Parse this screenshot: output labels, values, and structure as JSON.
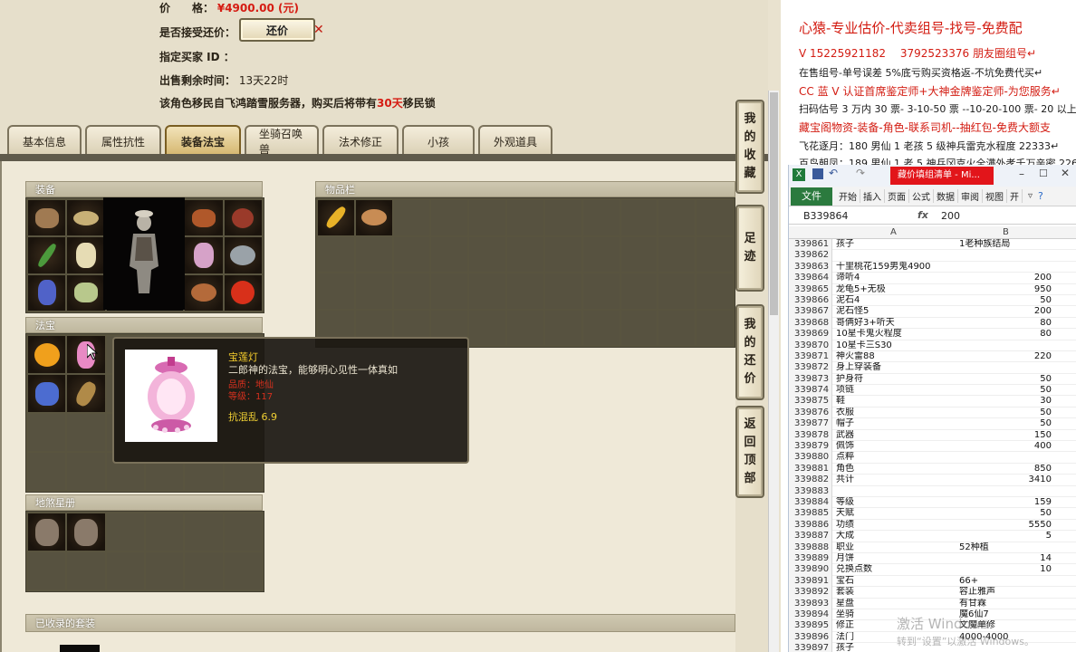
{
  "game": {
    "price_label": "价　　格：",
    "price_value": "¥4900.00 (元)",
    "accept_bargain_label": "是否接受还价：",
    "bargain_button": "还价",
    "designated_buyer_label": "指定买家 ID ：",
    "time_left_label": "出售剩余时间：",
    "time_left_value": "13天22时",
    "migration_note_pre": "该角色移民自飞鸿踏雪服务器，购买后将带有",
    "migration_days": "30天",
    "migration_note_post": "移民锁",
    "tabs": [
      "基本信息",
      "属性抗性",
      "装备法宝",
      "坐骑召唤兽",
      "法术修正",
      "小孩",
      "外观道具"
    ],
    "active_tab": "装备法宝",
    "panels": {
      "equipment": "装备",
      "items": "物品栏",
      "treasure": "法宝",
      "earth_book": "地煞星册",
      "collected_sets": "已收录的套装"
    },
    "tooltip": {
      "name": "宝莲灯",
      "desc": "二郎神的法宝，能够明心见性一体真如",
      "line1": "品质：地仙",
      "line2": "等级：117",
      "stat": "抗混乱 6.9"
    },
    "side_buttons": [
      [
        "我",
        "的",
        "收",
        "藏"
      ],
      [
        "足",
        "迹"
      ],
      [
        "我",
        "的",
        "还",
        "价"
      ],
      [
        "返",
        "回",
        "顶",
        "部"
      ]
    ]
  },
  "ad": {
    "line1": "心猿-专业估价-代卖组号-找号-免费配",
    "line2": "V 15225921182　 3792523376 朋友圈组号↵",
    "line3": "在售组号-单号误差 5%底亏购买资格返-不坑免费代买↵",
    "line4": "CC 蓝 V 认证首席鉴定师+大神金牌鉴定师-为您服务↵",
    "line5": "扫码估号 3 万内 30 票- 3-10-50 票 --10-20-100 票- 20 以上 150",
    "line6": "藏宝阁物资-装备-角色-联系司机--抽红包-免费大额支",
    "line7": "飞花逐月：180 男仙 1 老孩 5 级神兵雷克水程度 22333↵",
    "line8": "百鸟朝凤：189 男仙 1 老 5 神兵冈克火全满外孝千万亲密 226"
  },
  "excel": {
    "window_title": "藏价填组清单 - Mi...",
    "file_tab": "文件",
    "ribbon_tabs": [
      "开始",
      "插入",
      "页面",
      "公式",
      "数据",
      "审阅",
      "视图",
      "开"
    ],
    "name_box": "B339864",
    "fx": "fx",
    "formula_value": "200",
    "col_a": "A",
    "col_b": "B",
    "rows": [
      {
        "n": "339861",
        "a": "孩子",
        "b": "1老种族结局",
        "bn": false
      },
      {
        "n": "339862",
        "a": "",
        "b": "",
        "bn": false
      },
      {
        "n": "339863",
        "a": "十里桃花159男鬼4900",
        "b": "",
        "bn": false
      },
      {
        "n": "339864",
        "a": "谛听4",
        "b": "200",
        "bn": true
      },
      {
        "n": "339865",
        "a": "龙龟5+无极",
        "b": "950",
        "bn": true
      },
      {
        "n": "339866",
        "a": "泥石4",
        "b": "50",
        "bn": true
      },
      {
        "n": "339867",
        "a": "泥石怪5",
        "b": "200",
        "bn": true
      },
      {
        "n": "339868",
        "a": "哥俩好3+听天",
        "b": "80",
        "bn": true
      },
      {
        "n": "339869",
        "a": "10星卡鬼火程度",
        "b": "80",
        "bn": true
      },
      {
        "n": "339870",
        "a": "10星卡三S30",
        "b": "",
        "bn": false
      },
      {
        "n": "339871",
        "a": "神火雷88",
        "b": "220",
        "bn": true
      },
      {
        "n": "339872",
        "a": "身上穿装备",
        "b": "",
        "bn": false
      },
      {
        "n": "339873",
        "a": "护身符",
        "b": "50",
        "bn": true
      },
      {
        "n": "339874",
        "a": "项链",
        "b": "50",
        "bn": true
      },
      {
        "n": "339875",
        "a": "鞋",
        "b": "30",
        "bn": true
      },
      {
        "n": "339876",
        "a": "衣服",
        "b": "50",
        "bn": true
      },
      {
        "n": "339877",
        "a": "帽子",
        "b": "50",
        "bn": true
      },
      {
        "n": "339878",
        "a": "武器",
        "b": "150",
        "bn": true
      },
      {
        "n": "339879",
        "a": "佩饰",
        "b": "400",
        "bn": true
      },
      {
        "n": "339880",
        "a": "点粹",
        "b": "",
        "bn": false
      },
      {
        "n": "339881",
        "a": "角色",
        "b": "850",
        "bn": true
      },
      {
        "n": "339882",
        "a": "共计",
        "b": "3410",
        "bn": true
      },
      {
        "n": "339883",
        "a": "",
        "b": "",
        "bn": false
      },
      {
        "n": "339884",
        "a": "等级",
        "b": "159",
        "bn": true
      },
      {
        "n": "339885",
        "a": "天赋",
        "b": "50",
        "bn": true
      },
      {
        "n": "339886",
        "a": "功绩",
        "b": "5550",
        "bn": true
      },
      {
        "n": "339887",
        "a": "大成",
        "b": "5",
        "bn": true
      },
      {
        "n": "339888",
        "a": "职业",
        "b": "52种植",
        "bn": false
      },
      {
        "n": "339889",
        "a": "月饼",
        "b": "14",
        "bn": true
      },
      {
        "n": "339890",
        "a": "兑换点数",
        "b": "10",
        "bn": true
      },
      {
        "n": "339891",
        "a": "宝石",
        "b": "66+",
        "bn": false
      },
      {
        "n": "339892",
        "a": "套装",
        "b": "容止雅声",
        "bn": false
      },
      {
        "n": "339893",
        "a": "星盘",
        "b": "有甘霖",
        "bn": false
      },
      {
        "n": "339894",
        "a": "坐骑",
        "b": "魔6仙7",
        "bn": false
      },
      {
        "n": "339895",
        "a": "修正",
        "b": "文魔单修",
        "bn": false
      },
      {
        "n": "339896",
        "a": "法门",
        "b": "4000-4000",
        "bn": false
      },
      {
        "n": "339897",
        "a": "孩子",
        "b": "",
        "bn": false
      }
    ]
  },
  "watermark": {
    "line1": "激活 Windows",
    "line2": "转到“设置”以激活 Windows。"
  }
}
